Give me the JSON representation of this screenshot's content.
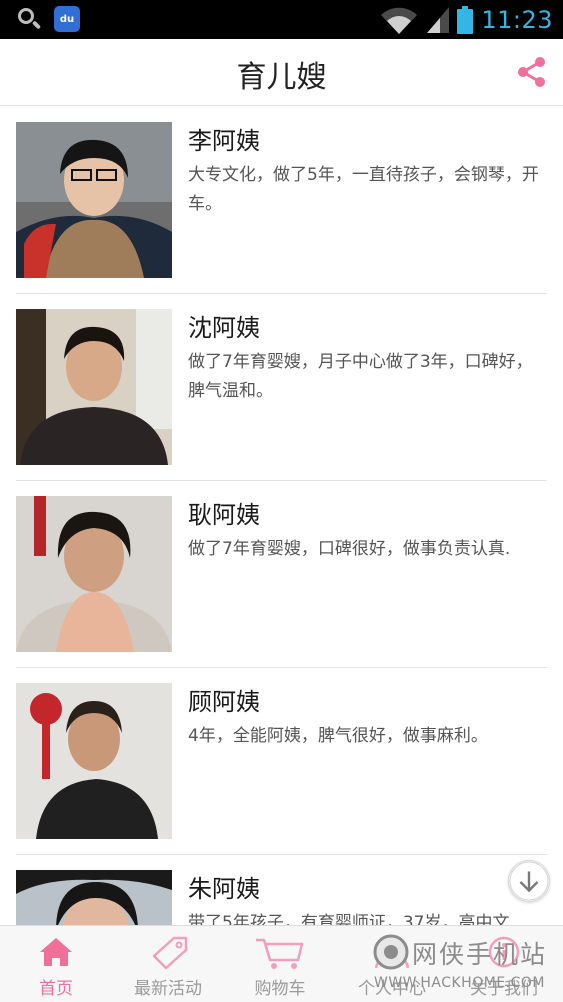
{
  "status_bar": {
    "time": "11:23",
    "baidu_label": "du"
  },
  "header": {
    "title": "育儿嫂"
  },
  "nannies": [
    {
      "name": "李阿姨",
      "description": "大专文化，做了5年，一直待孩子，会钢琴，开车。"
    },
    {
      "name": "沈阿姨",
      "description": "做了7年育婴嫂，月子中心做了3年，口碑好，脾气温和。"
    },
    {
      "name": "耿阿姨",
      "description": "做了7年育婴嫂，口碑很好，做事负责认真."
    },
    {
      "name": "顾阿姨",
      "description": "4年，全能阿姨，脾气很好，做事麻利。"
    },
    {
      "name": "朱阿姨",
      "description": "带了5年孩子，有育婴师证，37岁，高中文"
    }
  ],
  "tabs": [
    {
      "label": "首页",
      "icon": "home-icon",
      "active": true
    },
    {
      "label": "最新活动",
      "icon": "tag-icon",
      "active": false
    },
    {
      "label": "购物车",
      "icon": "cart-icon",
      "active": false
    },
    {
      "label": "个人中心",
      "icon": "person-icon",
      "active": false
    },
    {
      "label": "关于我们",
      "icon": "info-icon",
      "active": false
    }
  ],
  "watermark": {
    "chinese": "网侠手机站",
    "english": "WWW.HACKHOME.COM"
  },
  "colors": {
    "accent": "#f0709a",
    "status_bar_bg": "#000000",
    "status_bar_fg": "#33b5e5"
  }
}
